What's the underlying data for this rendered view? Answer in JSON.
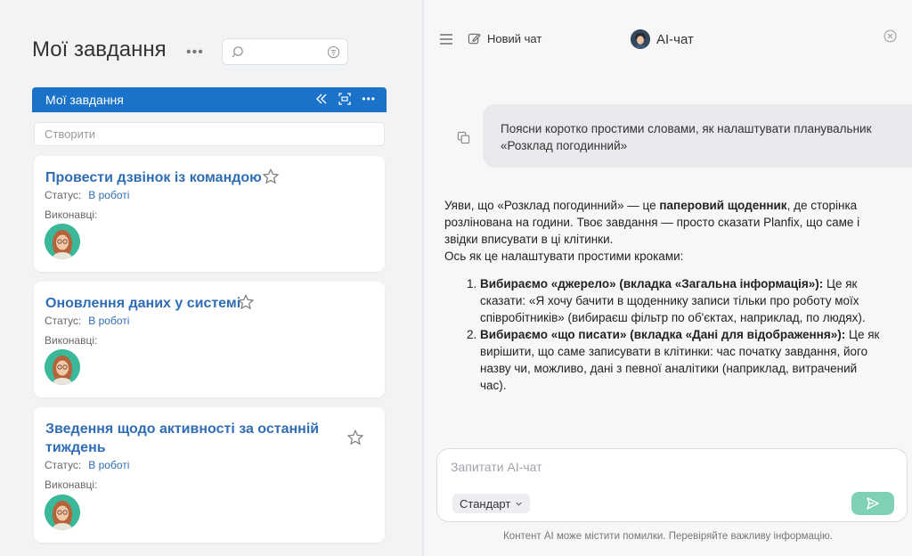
{
  "left": {
    "title": "Мої завдання",
    "search": {
      "placeholder": ""
    },
    "list_header": {
      "title": "Мої завдання"
    },
    "create_placeholder": "Створити",
    "tasks": [
      {
        "title": "Провести дзвінок із командою",
        "status_label": "Статус:",
        "status_value": "В роботі",
        "executors_label": "Виконавці:"
      },
      {
        "title": "Оновлення даних у системі",
        "status_label": "Статус:",
        "status_value": "В роботі",
        "executors_label": "Виконавці:"
      },
      {
        "title": "Зведення щодо активності за останній тиждень",
        "status_label": "Статус:",
        "status_value": "В роботі",
        "executors_label": "Виконавці:"
      }
    ]
  },
  "chat": {
    "new_chat_label": "Новий чат",
    "title": "AI-чат",
    "user_message": "Поясни коротко простими словами, як налаштувати планувальник «Розклад погодинний»",
    "answer": {
      "p1_a": "Уяви, що «Розклад погодинний» — це ",
      "p1_bold": "паперовий щоденник",
      "p1_b": ", де сторінка розлінована на години. Твоє завдання — просто сказати Planfix, що саме і звідки вписувати в ці клітинки.",
      "p2": "Ось як це налаштувати простими кроками:",
      "steps": [
        {
          "bold": "Вибираємо «джерело» (вкладка «Загальна інформація»):",
          "text": " Це як сказати: «Я хочу бачити в щоденнику записи тільки про роботу моїх співробітників» (вибираєш фільтр по об'єктах, наприклад, по людях)."
        },
        {
          "bold": "Вибираємо «що писати» (вкладка «Дані для відображення»):",
          "text": " Це як вирішити, що саме записувати в клітинки: час початку завдання, його назву чи, можливо, дані з певної аналітики (наприклад, витрачений час)."
        }
      ]
    },
    "input_placeholder": "Запитати AI-чат",
    "mode": "Стандарт",
    "disclaimer": "Контент AI може містити помилки. Перевіряйте важливу інформацію."
  },
  "colors": {
    "accent_blue": "#1a73c9",
    "link_blue": "#2f6db5",
    "send_green": "#7fd1b3"
  },
  "icons": [
    "more-dots-icon",
    "search-icon",
    "filter-icon",
    "collapse-icon",
    "fullscreen-icon",
    "star-icon",
    "menu-icon",
    "edit-icon",
    "close-icon",
    "copy-icon",
    "chevron-down-icon",
    "send-icon"
  ]
}
